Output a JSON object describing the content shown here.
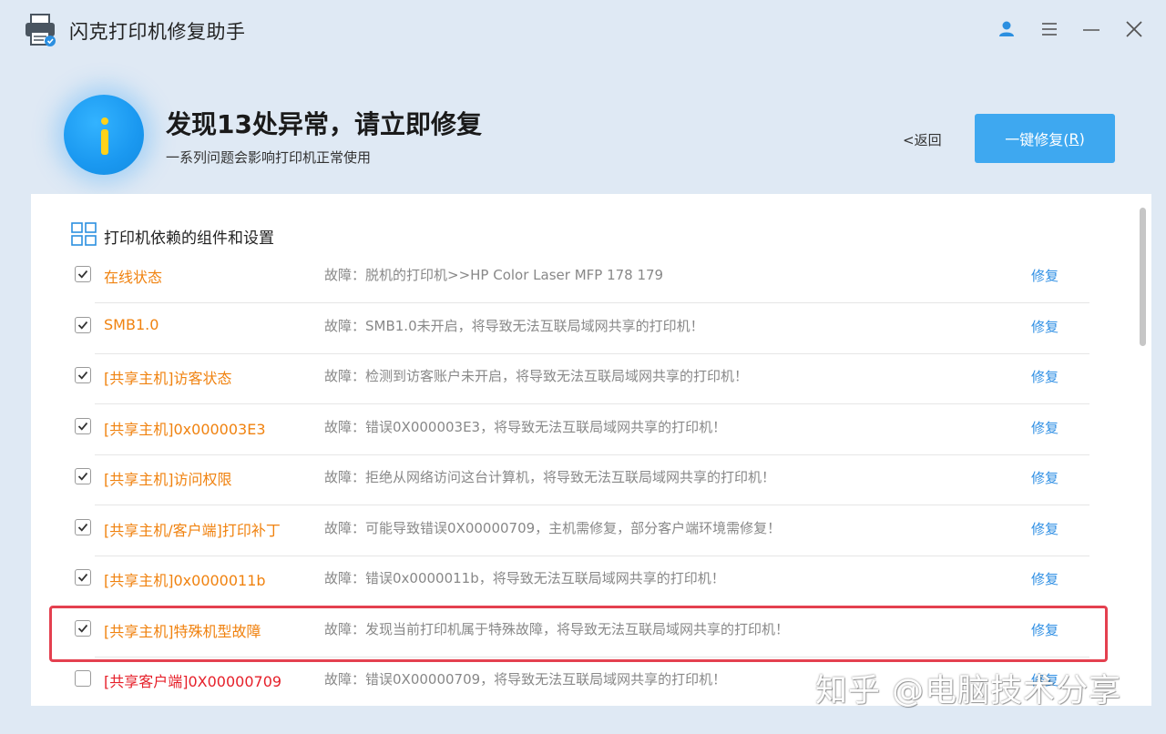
{
  "app": {
    "title": "闪克打印机修复助手"
  },
  "window_controls": {
    "user_icon": "user-icon",
    "menu_icon": "menu-icon",
    "minimize_icon": "minimize-icon",
    "close_icon": "close-icon"
  },
  "header": {
    "title": "发现13处异常，请立即修复",
    "subtitle": "一系列问题会影响打印机正常使用",
    "back_label": "<返回",
    "fix_all_label": "一键修复(",
    "fix_all_shortcut": "R",
    "fix_all_close": ")"
  },
  "section": {
    "icon": "grid-icon",
    "title": "打印机依赖的组件和设置"
  },
  "items": [
    {
      "name": "在线状态",
      "fault": "故障：脱机的打印机>>HP Color Laser MFP 178 179",
      "action": "修复",
      "checked": true
    },
    {
      "name": "SMB1.0",
      "fault": "故障：SMB1.0未开启，将导致无法互联局域网共享的打印机！",
      "action": "修复",
      "checked": true
    },
    {
      "name": "[共享主机]访客状态",
      "fault": "故障：检测到访客账户未开启，将导致无法互联局域网共享的打印机！",
      "action": "修复",
      "checked": true
    },
    {
      "name": "[共享主机]0x000003E3",
      "fault": "故障：错误0X000003E3，将导致无法互联局域网共享的打印机！",
      "action": "修复",
      "checked": true
    },
    {
      "name": "[共享主机]访问权限",
      "fault": "故障：拒绝从网络访问这台计算机，将导致无法互联局域网共享的打印机！",
      "action": "修复",
      "checked": true
    },
    {
      "name": "[共享主机/客户端]打印补丁",
      "fault": "故障：可能导致错误0X00000709，主机需修复，部分客户端环境需修复！",
      "action": "修复",
      "checked": true
    },
    {
      "name": "[共享主机]0x0000011b",
      "fault": "故障：错误0x0000011b，将导致无法互联局域网共享的打印机！",
      "action": "修复",
      "checked": true
    },
    {
      "name": "[共享主机]特殊机型故障",
      "fault": "故障：发现当前打印机属于特殊故障，将导致无法互联局域网共享的打印机！",
      "action": "修复",
      "checked": true
    },
    {
      "name": "[共享客户端]0X00000709",
      "fault": "故障：错误0X00000709，将导致无法互联局域网共享的打印机！",
      "action": "修复",
      "checked": false
    }
  ],
  "watermark": "知乎 @电脑技术分享",
  "colors": {
    "background": "#dfe9f4",
    "accent": "#3ea8f0",
    "item_name": "#f0820f",
    "item_name_unchecked": "#e6202a",
    "fix_link": "#2f8fe4",
    "highlight": "#e4404f"
  }
}
